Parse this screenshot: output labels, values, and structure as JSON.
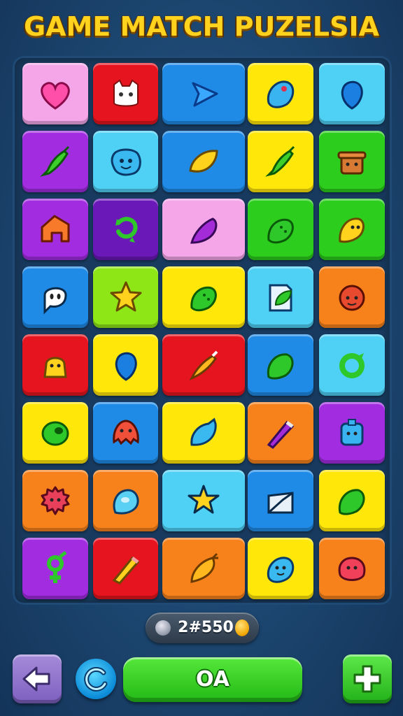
{
  "header": {
    "title": "GAME MATCH PUZELSIA"
  },
  "colors": {
    "pink": "#f4a6e8",
    "red": "#e5141e",
    "blue": "#1f8be6",
    "yellow": "#ffe70a",
    "lightblue": "#4fd0f5",
    "purple": "#a12ce0",
    "green": "#2ccd1c",
    "darkpurple": "#6a18b8",
    "lightgreen": "#8ee617",
    "orange": "#f7821c"
  },
  "board": {
    "rows": [
      [
        {
          "color": "pink",
          "icon": "heart-icon"
        },
        {
          "color": "red",
          "icon": "cat-face-icon"
        },
        {
          "color": "blue",
          "icon": "triangle-arrow-icon"
        },
        {
          "color": "yellow",
          "icon": "blue-blob-icon"
        },
        {
          "color": "lightblue",
          "icon": "blue-drop-icon"
        }
      ],
      [
        {
          "color": "purple",
          "icon": "green-pepper-icon"
        },
        {
          "color": "lightblue",
          "icon": "smiley-blob-icon"
        },
        {
          "color": "blue",
          "icon": "lemon-icon"
        },
        {
          "color": "yellow",
          "icon": "green-pepper-icon"
        },
        {
          "color": "green",
          "icon": "pot-creature-icon"
        }
      ],
      [
        {
          "color": "purple",
          "icon": "house-creature-icon"
        },
        {
          "color": "darkpurple",
          "icon": "green-swirl-icon"
        },
        {
          "color": "pink",
          "icon": "purple-eggplant-icon"
        },
        {
          "color": "green",
          "icon": "green-fish-icon"
        },
        {
          "color": "green",
          "icon": "yellow-bird-icon"
        }
      ],
      [
        {
          "color": "blue",
          "icon": "ghost-icon"
        },
        {
          "color": "lightgreen",
          "icon": "star-icon"
        },
        {
          "color": "yellow",
          "icon": "green-fish-icon"
        },
        {
          "color": "lightblue",
          "icon": "leaf-card-icon"
        },
        {
          "color": "orange",
          "icon": "red-face-icon"
        }
      ],
      [
        {
          "color": "red",
          "icon": "yellow-bell-icon"
        },
        {
          "color": "yellow",
          "icon": "blue-drop-icon"
        },
        {
          "color": "red",
          "icon": "carrot-icon"
        },
        {
          "color": "blue",
          "icon": "green-drop-icon"
        },
        {
          "color": "lightblue",
          "icon": "green-ring-icon"
        }
      ],
      [
        {
          "color": "yellow",
          "icon": "green-bean-icon"
        },
        {
          "color": "blue",
          "icon": "red-octopus-icon"
        },
        {
          "color": "yellow",
          "icon": "blue-bottle-icon"
        },
        {
          "color": "orange",
          "icon": "purple-crayon-icon"
        },
        {
          "color": "purple",
          "icon": "blue-cube-icon"
        }
      ],
      [
        {
          "color": "orange",
          "icon": "red-gear-icon"
        },
        {
          "color": "orange",
          "icon": "blue-bubble-icon"
        },
        {
          "color": "lightblue",
          "icon": "yellow-star-icon"
        },
        {
          "color": "blue",
          "icon": "envelope-icon"
        },
        {
          "color": "yellow",
          "icon": "green-drop-icon"
        }
      ],
      [
        {
          "color": "purple",
          "icon": "green-symbol-icon"
        },
        {
          "color": "red",
          "icon": "yellow-pencil-icon"
        },
        {
          "color": "orange",
          "icon": "orange-carrot-icon"
        },
        {
          "color": "yellow",
          "icon": "blue-smiley-icon"
        },
        {
          "color": "orange",
          "icon": "red-blob-icon"
        }
      ]
    ]
  },
  "score": {
    "value": "2#550"
  },
  "controls": {
    "ok_label": "OA"
  }
}
